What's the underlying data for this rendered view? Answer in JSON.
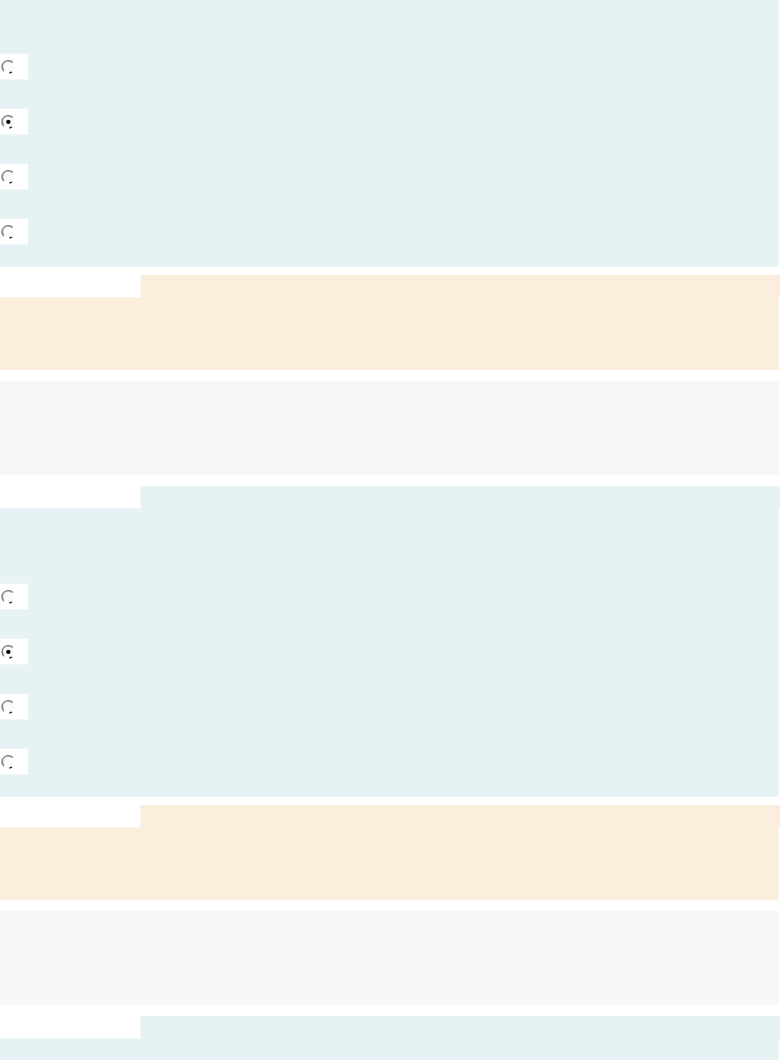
{
  "blocks": [
    {
      "kind": "question",
      "tab": false,
      "options": [
        {
          "selected": false
        },
        {
          "selected": true
        },
        {
          "selected": false
        },
        {
          "selected": false
        }
      ]
    },
    {
      "kind": "feedback",
      "tab": true
    },
    {
      "kind": "explanation",
      "tab": false
    },
    {
      "kind": "question",
      "tab": true,
      "options": [
        {
          "selected": false
        },
        {
          "selected": true
        },
        {
          "selected": false
        },
        {
          "selected": false
        }
      ]
    },
    {
      "kind": "feedback",
      "tab": true
    },
    {
      "kind": "explanation",
      "tab": false
    },
    {
      "kind": "question",
      "tab": true
    }
  ]
}
